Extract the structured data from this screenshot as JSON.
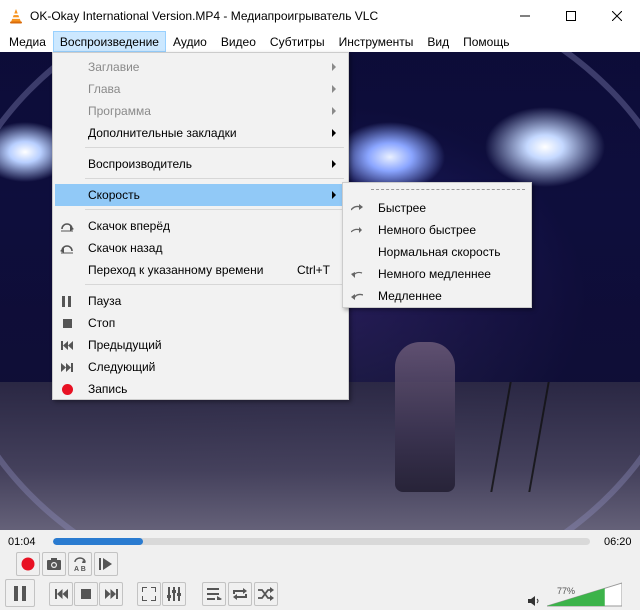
{
  "window": {
    "title": "OK-Okay International Version.MP4 - Медиапроигрыватель VLC"
  },
  "menubar": {
    "items": [
      "Медиа",
      "Воспроизведение",
      "Аудио",
      "Видео",
      "Субтитры",
      "Инструменты",
      "Вид",
      "Помощь"
    ]
  },
  "playback_menu": {
    "items": [
      {
        "label": "Заглавие",
        "enabled": false,
        "submenu": true
      },
      {
        "label": "Глава",
        "enabled": false,
        "submenu": true
      },
      {
        "label": "Программа",
        "enabled": false,
        "submenu": true
      },
      {
        "label": "Дополнительные закладки",
        "enabled": true,
        "submenu": true
      },
      {
        "label": "Воспроизводитель",
        "enabled": true,
        "submenu": true
      },
      {
        "label": "Скорость",
        "enabled": true,
        "submenu": true,
        "highlighted": true
      },
      {
        "label": "Скачок вперёд",
        "icon": "jump-forward-icon"
      },
      {
        "label": "Скачок назад",
        "icon": "jump-back-icon"
      },
      {
        "label": "Переход к указанному времени",
        "shortcut": "Ctrl+T"
      },
      {
        "label": "Пауза",
        "icon": "pause-icon"
      },
      {
        "label": "Стоп",
        "icon": "stop-icon"
      },
      {
        "label": "Предыдущий",
        "icon": "previous-icon"
      },
      {
        "label": "Следующий",
        "icon": "next-icon"
      },
      {
        "label": "Запись",
        "icon": "record-icon"
      }
    ]
  },
  "speed_menu": {
    "items": [
      {
        "label": "Быстрее",
        "icon": "faster-icon"
      },
      {
        "label": "Немного быстрее",
        "icon": "faster-fine-icon"
      },
      {
        "label": "Нормальная скорость",
        "icon": ""
      },
      {
        "label": "Немного медленнее",
        "icon": "slower-fine-icon"
      },
      {
        "label": "Медленнее",
        "icon": "slower-icon"
      }
    ]
  },
  "player": {
    "elapsed": "01:04",
    "total": "06:20",
    "progress": 0.168,
    "volume_label": "77%",
    "volume": 0.77
  },
  "colors": {
    "accent": "#2a7bd0",
    "record": "#e81123",
    "menu_highlight": "#91c9f7",
    "volume_fill": "#3cb34a"
  }
}
